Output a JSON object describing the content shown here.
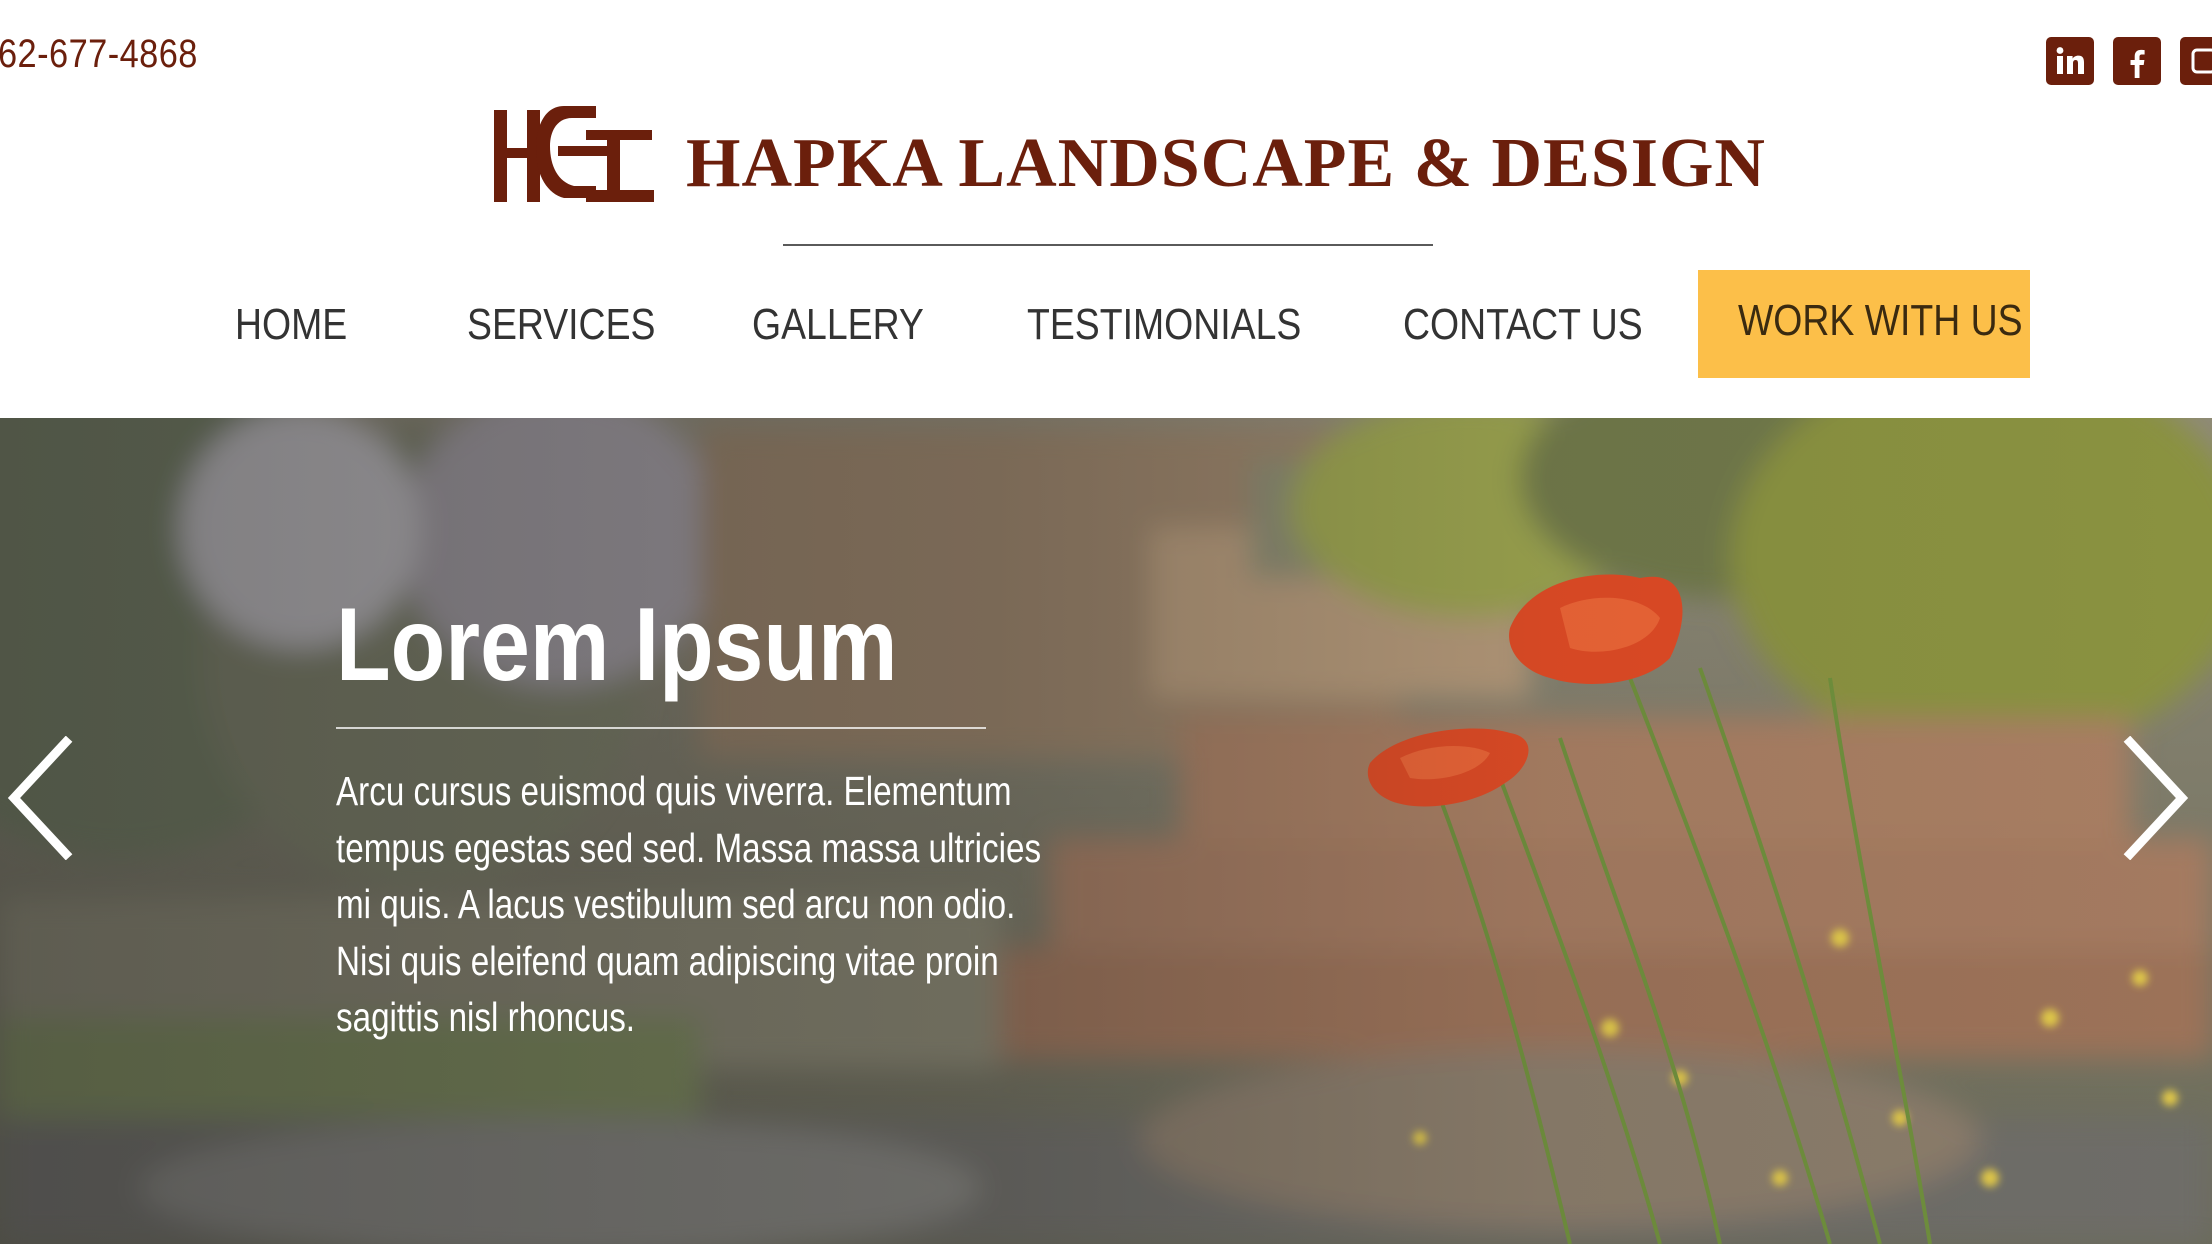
{
  "header": {
    "phone": "62-677-4868",
    "brand_name": "HAPKA LANDSCAPE & DESIGN",
    "logo_icon": "hld-monogram-logo",
    "social": [
      {
        "name": "linkedin",
        "icon": "linkedin-icon"
      },
      {
        "name": "facebook",
        "icon": "facebook-icon"
      },
      {
        "name": "other",
        "icon": "social-icon"
      }
    ]
  },
  "nav": {
    "items": [
      {
        "label": "HOME"
      },
      {
        "label": "SERVICES"
      },
      {
        "label": "GALLERY"
      },
      {
        "label": "TESTIMONIALS"
      },
      {
        "label": "CONTACT US"
      }
    ],
    "cta_label": "WORK WITH US"
  },
  "hero": {
    "title": "Lorem Ipsum",
    "body_lines": [
      "Arcu cursus euismod quis viverra. Elementum",
      "tempus egestas sed sed. Massa massa ultricies",
      "mi quis. A lacus vestibulum sed arcu non odio.",
      "Nisi quis eleifend quam adipiscing vitae proin",
      "sagittis nisl rhoncus."
    ],
    "prev_icon": "chevron-left-icon",
    "next_icon": "chevron-right-icon"
  },
  "colors": {
    "brand": "#6b1f0c",
    "cta": "#fcbf49",
    "nav_text": "#333333",
    "hero_text": "#ffffff"
  }
}
